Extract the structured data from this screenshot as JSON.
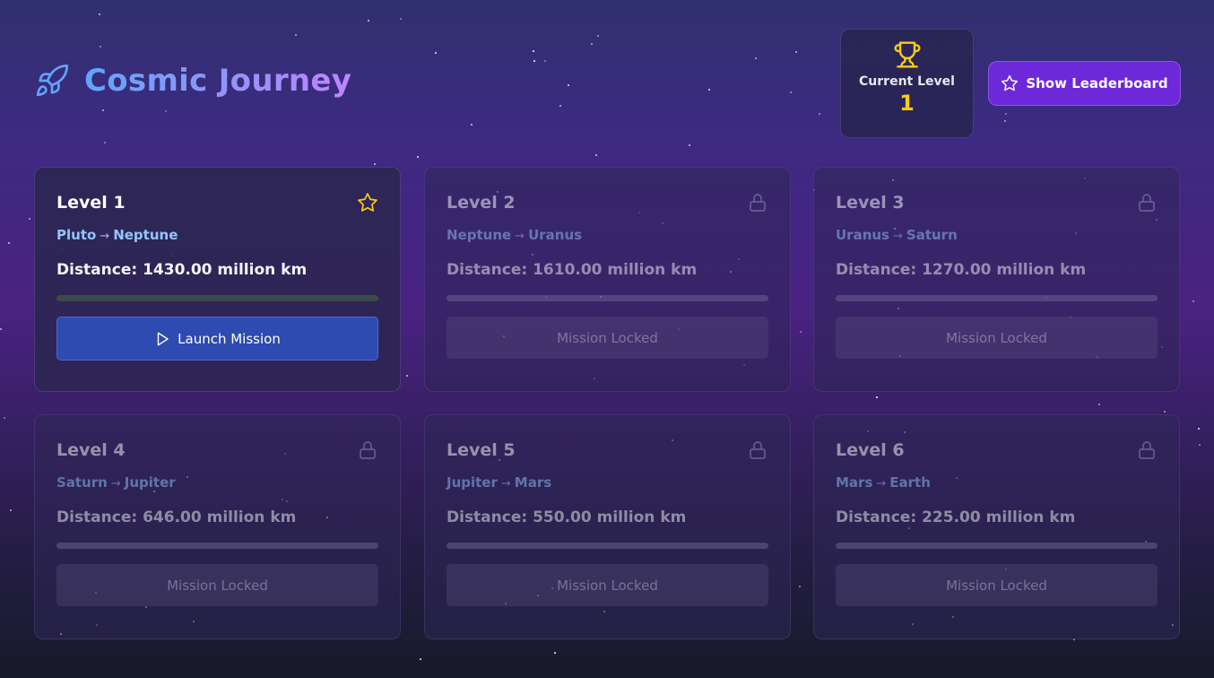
{
  "header": {
    "title": "Cosmic Journey",
    "icon": "rocket-icon",
    "accent_from": "#60a5fa",
    "accent_to": "#c084fc"
  },
  "current_level": {
    "label": "Current Level",
    "value": "1",
    "icon": "trophy-icon",
    "value_color": "#facc15"
  },
  "leaderboard_button": {
    "label": "Show Leaderboard",
    "icon": "star-icon",
    "color": "#6d28d9"
  },
  "levels": [
    {
      "title": "Level 1",
      "from": "Pluto",
      "to": "Neptune",
      "distance": "Distance: 1430.00 million km",
      "status": "active",
      "progress": 0,
      "button": "Launch Mission",
      "icon": "star-icon"
    },
    {
      "title": "Level 2",
      "from": "Neptune",
      "to": "Uranus",
      "distance": "Distance: 1610.00 million km",
      "status": "locked",
      "progress": 0,
      "button": "Mission Locked",
      "icon": "lock-icon"
    },
    {
      "title": "Level 3",
      "from": "Uranus",
      "to": "Saturn",
      "distance": "Distance: 1270.00 million km",
      "status": "locked",
      "progress": 0,
      "button": "Mission Locked",
      "icon": "lock-icon"
    },
    {
      "title": "Level 4",
      "from": "Saturn",
      "to": "Jupiter",
      "distance": "Distance: 646.00 million km",
      "status": "locked",
      "progress": 0,
      "button": "Mission Locked",
      "icon": "lock-icon"
    },
    {
      "title": "Level 5",
      "from": "Jupiter",
      "to": "Mars",
      "distance": "Distance: 550.00 million km",
      "status": "locked",
      "progress": 0,
      "button": "Mission Locked",
      "icon": "lock-icon"
    },
    {
      "title": "Level 6",
      "from": "Mars",
      "to": "Earth",
      "distance": "Distance: 225.00 million km",
      "status": "locked",
      "progress": 0,
      "button": "Mission Locked",
      "icon": "lock-icon"
    }
  ],
  "route_arrow": "→"
}
